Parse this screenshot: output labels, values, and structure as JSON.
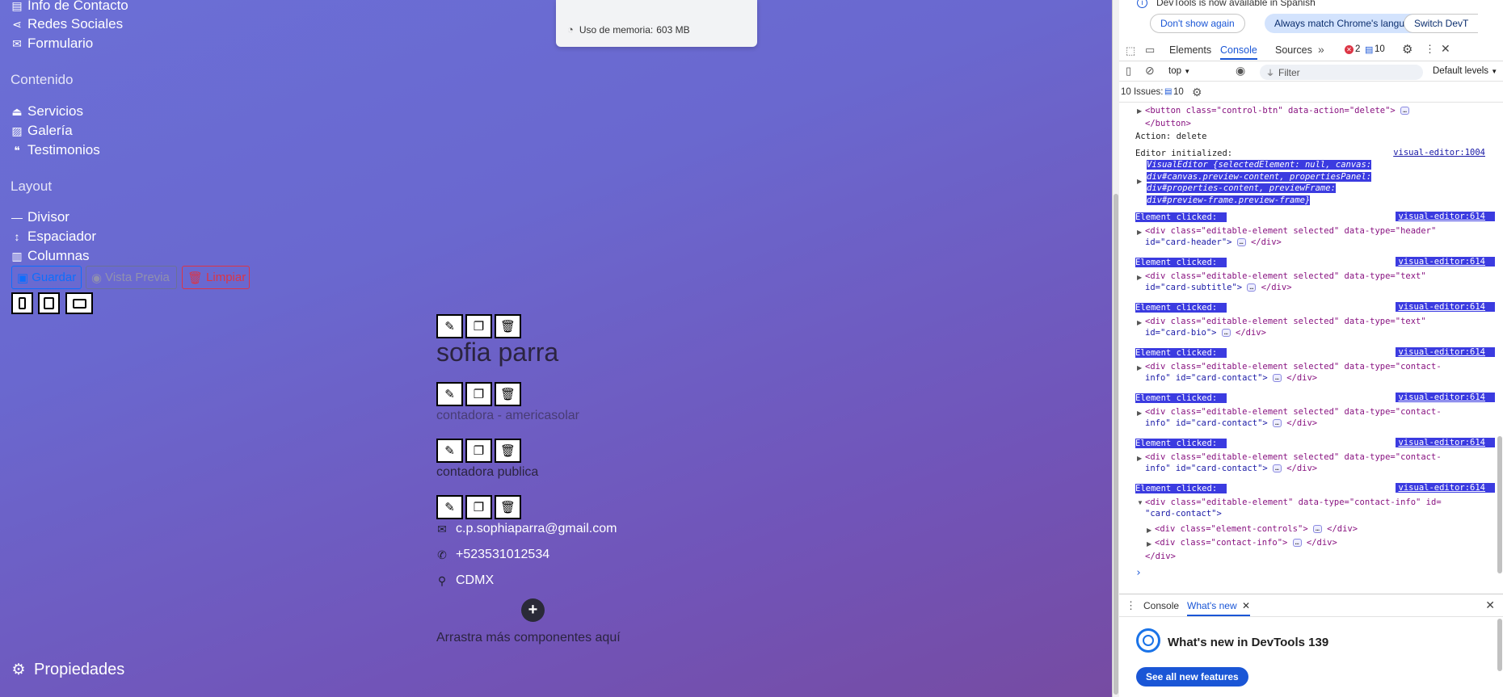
{
  "sidebar": {
    "items_top": [
      {
        "label": "Info de Contacto",
        "icon": "contact-card-icon"
      },
      {
        "label": "Redes Sociales",
        "icon": "share-icon"
      },
      {
        "label": "Formulario",
        "icon": "envelope-icon"
      }
    ],
    "section_content": "Contenido",
    "items_content": [
      {
        "label": "Servicios",
        "icon": "bell-icon"
      },
      {
        "label": "Galería",
        "icon": "images-icon"
      },
      {
        "label": "Testimonios",
        "icon": "quote-icon"
      }
    ],
    "section_layout": "Layout",
    "items_layout": [
      {
        "label": "Divisor",
        "icon": "minus-icon"
      },
      {
        "label": "Espaciador",
        "icon": "arrows-vertical-icon"
      },
      {
        "label": "Columnas",
        "icon": "columns-icon"
      }
    ],
    "properties": "Propiedades"
  },
  "toolbar": {
    "save_label": "Guardar",
    "preview_label": "Vista Previa",
    "clear_label": "Limpiar"
  },
  "memory_popup": {
    "label": "Uso de memoria:",
    "value": "603 MB"
  },
  "card": {
    "name": "sofia parra",
    "subtitle": "contadora - americasolar",
    "bio": "contadora publica",
    "email": "c.p.sophiaparra@gmail.com",
    "phone": "+523531012534",
    "location": "CDMX",
    "drop_hint": "Arrastra más componentes aquí"
  },
  "devtools": {
    "lang_notice": "DevTools is now available in Spanish",
    "btn_dont_show": "Don't show again",
    "btn_match": "Always match Chrome's language",
    "btn_switch": "Switch DevT",
    "tabs": [
      "Elements",
      "Console",
      "Sources"
    ],
    "error_count": "2",
    "issue_count": "10",
    "context": "top",
    "filter_placeholder": "Filter",
    "levels": "Default levels",
    "issues_label": "10 Issues:",
    "issues_num": "10",
    "log": {
      "button_line1_a": "<button class=\"control-btn\" data-action=\"delete\">",
      "button_line2": "</button>",
      "action": "Action: delete",
      "editor_init": "Editor initialized:",
      "editor_link": "visual-editor:1004",
      "visual_editor_1": "VisualEditor {selectedElement: null, canvas:",
      "visual_editor_2": "div#canvas.preview-content, propertiesPanel:",
      "visual_editor_3": "div#properties-content, previewFrame:",
      "visual_editor_4": "div#preview-frame.preview-frame}",
      "clicked": "Element clicked:",
      "clicked_link": "visual-editor:614",
      "entries": [
        {
          "l1": "<div class=\"editable-element selected\" data-type=\"header\"",
          "l2": "id=\"card-header\">"
        },
        {
          "l1": "<div class=\"editable-element selected\" data-type=\"text\"",
          "l2": "id=\"card-subtitle\">"
        },
        {
          "l1": "<div class=\"editable-element selected\" data-type=\"text\"",
          "l2": "id=\"card-bio\">"
        },
        {
          "l1": "<div class=\"editable-element selected\" data-type=\"contact-",
          "l2": "info\" id=\"card-contact\">"
        },
        {
          "l1": "<div class=\"editable-element selected\" data-type=\"contact-",
          "l2": "info\" id=\"card-contact\">"
        },
        {
          "l1": "<div class=\"editable-element selected\" data-type=\"contact-",
          "l2": "info\" id=\"card-contact\">"
        }
      ],
      "last_l1": "<div class=\"editable-element\" data-type=\"contact-info\" id=",
      "last_l2": "\"card-contact\">",
      "last_child1": "<div class=\"element-controls\">",
      "last_child2": "<div class=\"contact-info\">",
      "close_div": "</div>",
      "close_div_short": "</div>",
      "prompt": "›"
    },
    "drawer_tabs": [
      "Console",
      "What's new"
    ],
    "whatsnew_title": "What's new in DevTools 139",
    "see_all": "See all new features"
  }
}
